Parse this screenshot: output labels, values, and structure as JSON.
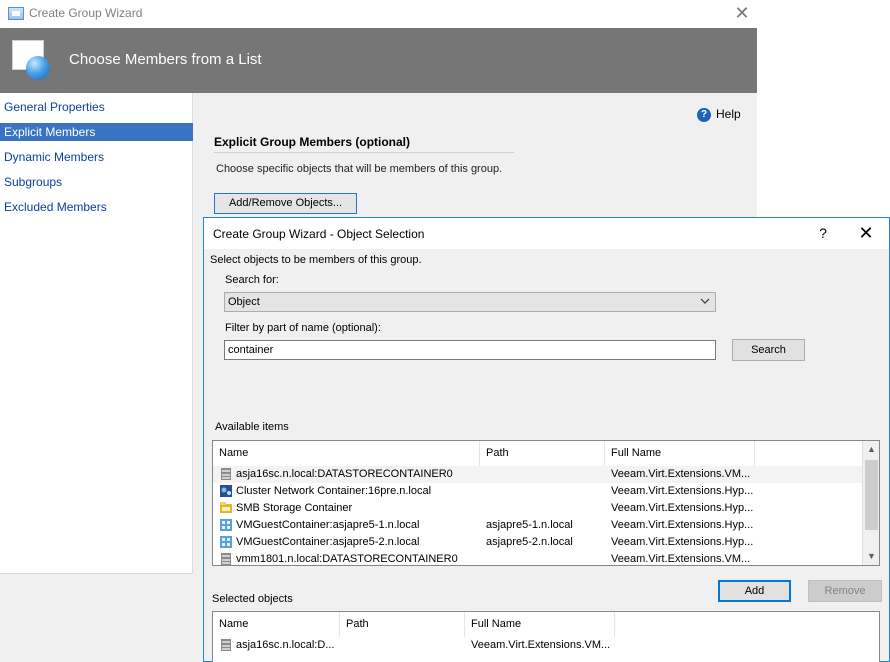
{
  "wizard": {
    "title": "Create Group Wizard",
    "close_glyph": "✕",
    "banner_title": "Choose Members from a List",
    "nav": [
      {
        "label": "General Properties",
        "selected": false
      },
      {
        "label": "Explicit Members",
        "selected": true
      },
      {
        "label": "Dynamic Members",
        "selected": false
      },
      {
        "label": "Subgroups",
        "selected": false
      },
      {
        "label": "Excluded Members",
        "selected": false
      }
    ],
    "help_label": "Help",
    "section_title": "Explicit Group Members (optional)",
    "section_desc": "Choose specific objects that will be members of this group.",
    "add_remove_label": "Add/Remove Objects..."
  },
  "dialog": {
    "title": "Create Group Wizard - Object Selection",
    "help_glyph": "?",
    "close_glyph": "✕",
    "description": "Select objects to be members of this group.",
    "search_for_label": "Search for:",
    "search_for_value": "Object",
    "filter_label": "Filter by part of name (optional):",
    "filter_value": "container",
    "search_button": "Search",
    "available_label": "Available items",
    "available_columns": [
      "Name",
      "Path",
      "Full Name"
    ],
    "available_rows": [
      {
        "icon": "datastore-icon",
        "name": "asja16sc.n.local:DATASTORECONTAINER0",
        "path": "",
        "full_name": "Veeam.Virt.Extensions.VM...",
        "selected": true
      },
      {
        "icon": "cluster-network-icon",
        "name": "Cluster Network Container:16pre.n.local",
        "path": "",
        "full_name": "Veeam.Virt.Extensions.Hyp...",
        "selected": false
      },
      {
        "icon": "smb-storage-icon",
        "name": "SMB Storage Container",
        "path": "",
        "full_name": "Veeam.Virt.Extensions.Hyp...",
        "selected": false
      },
      {
        "icon": "vm-guest-icon",
        "name": "VMGuestContainer:asjapre5-1.n.local",
        "path": "asjapre5-1.n.local",
        "full_name": "Veeam.Virt.Extensions.Hyp...",
        "selected": false
      },
      {
        "icon": "vm-guest-icon",
        "name": "VMGuestContainer:asjapre5-2.n.local",
        "path": "asjapre5-2.n.local",
        "full_name": "Veeam.Virt.Extensions.Hyp...",
        "selected": false
      },
      {
        "icon": "datastore-icon",
        "name": "vmm1801.n.local:DATASTORECONTAINER0",
        "path": "",
        "full_name": "Veeam.Virt.Extensions.VM...",
        "selected": false
      }
    ],
    "add_button": "Add",
    "remove_button": "Remove",
    "selected_label": "Selected objects",
    "selected_columns": [
      "Name",
      "Path",
      "Full Name"
    ],
    "selected_rows": [
      {
        "icon": "datastore-icon",
        "name": "asja16sc.n.local:D...",
        "path": "",
        "full_name": "Veeam.Virt.Extensions.VM..."
      }
    ]
  },
  "colors": {
    "banner": "#767676",
    "nav_selected": "#3a73c2",
    "dialog_border": "#1e88d8"
  }
}
